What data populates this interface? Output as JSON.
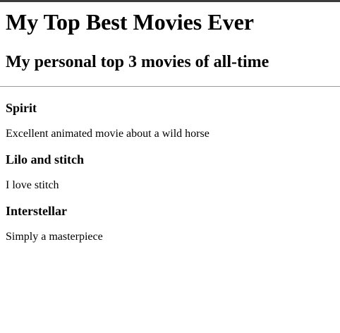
{
  "page": {
    "title": "My Top Best Movies Ever",
    "subtitle": "My personal top 3 movies of all-time"
  },
  "movies": [
    {
      "name": "Spirit",
      "description": "Excellent animated movie about a wild horse"
    },
    {
      "name": "Lilo and stitch",
      "description": "I love stitch"
    },
    {
      "name": "Interstellar",
      "description": "Simply a masterpiece"
    }
  ]
}
